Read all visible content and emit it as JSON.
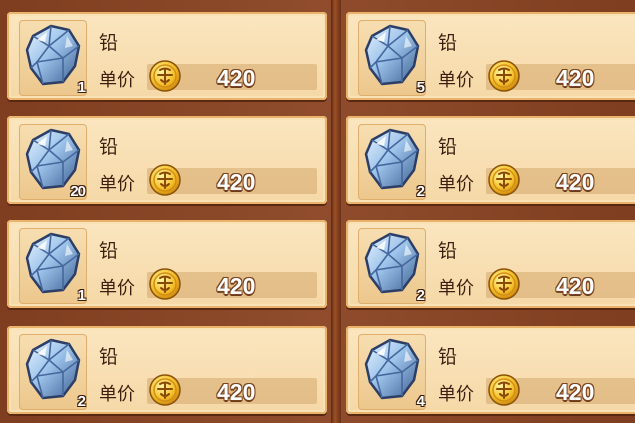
{
  "listings": [
    {
      "name": "铅",
      "quantity": "1",
      "price_label": "单价",
      "price": "420",
      "icon": "ore-crystal-icon"
    },
    {
      "name": "铅",
      "quantity": "5",
      "price_label": "单价",
      "price": "420",
      "icon": "ore-crystal-icon"
    },
    {
      "name": "铅",
      "quantity": "20",
      "price_label": "单价",
      "price": "420",
      "icon": "ore-crystal-icon"
    },
    {
      "name": "铅",
      "quantity": "2",
      "price_label": "单价",
      "price": "420",
      "icon": "ore-crystal-icon"
    },
    {
      "name": "铅",
      "quantity": "1",
      "price_label": "单价",
      "price": "420",
      "icon": "ore-crystal-icon"
    },
    {
      "name": "铅",
      "quantity": "2",
      "price_label": "单价",
      "price": "420",
      "icon": "ore-crystal-icon"
    },
    {
      "name": "铅",
      "quantity": "2",
      "price_label": "单价",
      "price": "420",
      "icon": "ore-crystal-icon"
    },
    {
      "name": "铅",
      "quantity": "4",
      "price_label": "单价",
      "price": "420",
      "icon": "ore-crystal-icon"
    }
  ],
  "currency_icon": "gold-coin-icon",
  "colors": {
    "background": "#8a4322",
    "card": "#f5d8a6",
    "text": "#3c1f10",
    "price_text": "#ffffff"
  }
}
